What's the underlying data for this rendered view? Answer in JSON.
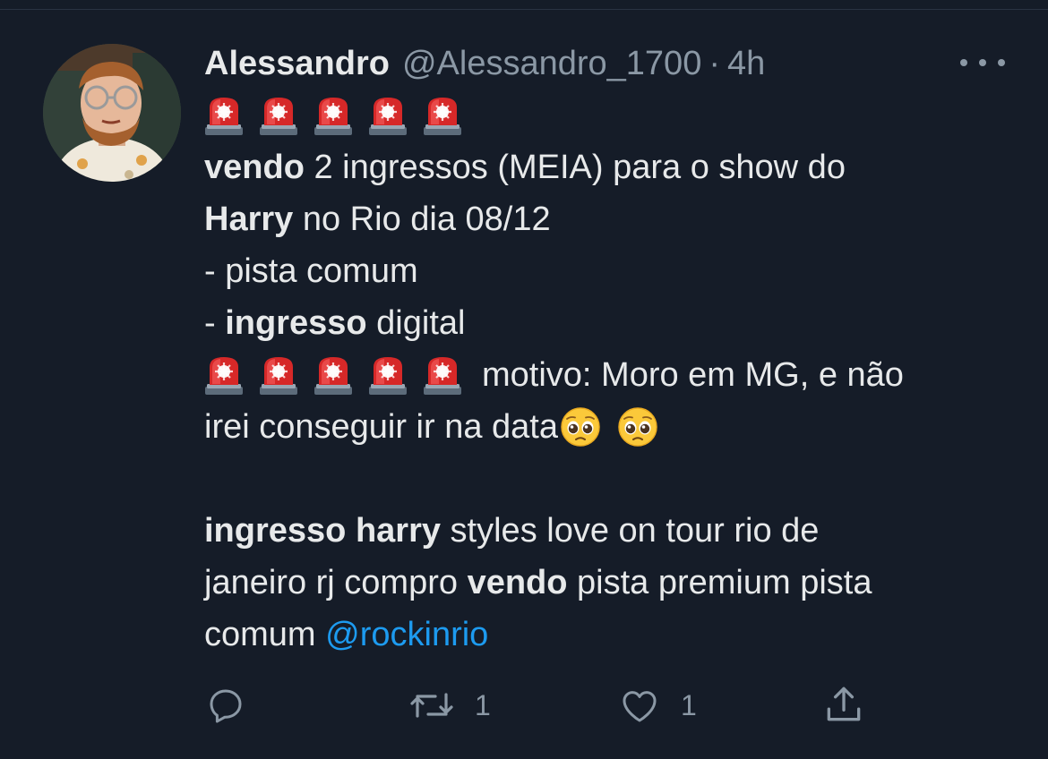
{
  "tweet": {
    "author_name": "Alessandro",
    "handle": "@Alessandro_1700",
    "separator": "·",
    "time": "4h",
    "lines": {
      "l3_p1": "vendo",
      "l3_p2": " 2 ingressos (MEIA) para o show do",
      "l4_p1": "Harry",
      "l4_p2": " no Rio dia 08/12",
      "l5": "- pista comum",
      "l6_p1": "- ",
      "l6_p2": "ingresso",
      "l6_p3": " digital",
      "l7_text": "motivo: Moro em MG, e não",
      "l8_text": "irei conseguir ir na data",
      "l10_p1": "ingresso harry",
      "l10_p2": " styles love on tour rio de",
      "l11_p1": "janeiro rj compro ",
      "l11_p2": "vendo",
      "l11_p3": " pista premium pista",
      "l12_p1": "comum ",
      "l12_mention": "@rockinrio"
    },
    "emojis": {
      "siren": "police-car-light-emoji",
      "pleading": "pleading-face-emoji"
    }
  },
  "actions": {
    "reply_icon": "reply-icon",
    "retweet_icon": "retweet-icon",
    "retweet_count": "1",
    "like_icon": "heart-icon",
    "like_count": "1",
    "share_icon": "share-icon"
  },
  "colors": {
    "background": "#151c28",
    "text": "#e7e9ea",
    "secondary": "#8b98a5",
    "link": "#1d9bf0"
  }
}
